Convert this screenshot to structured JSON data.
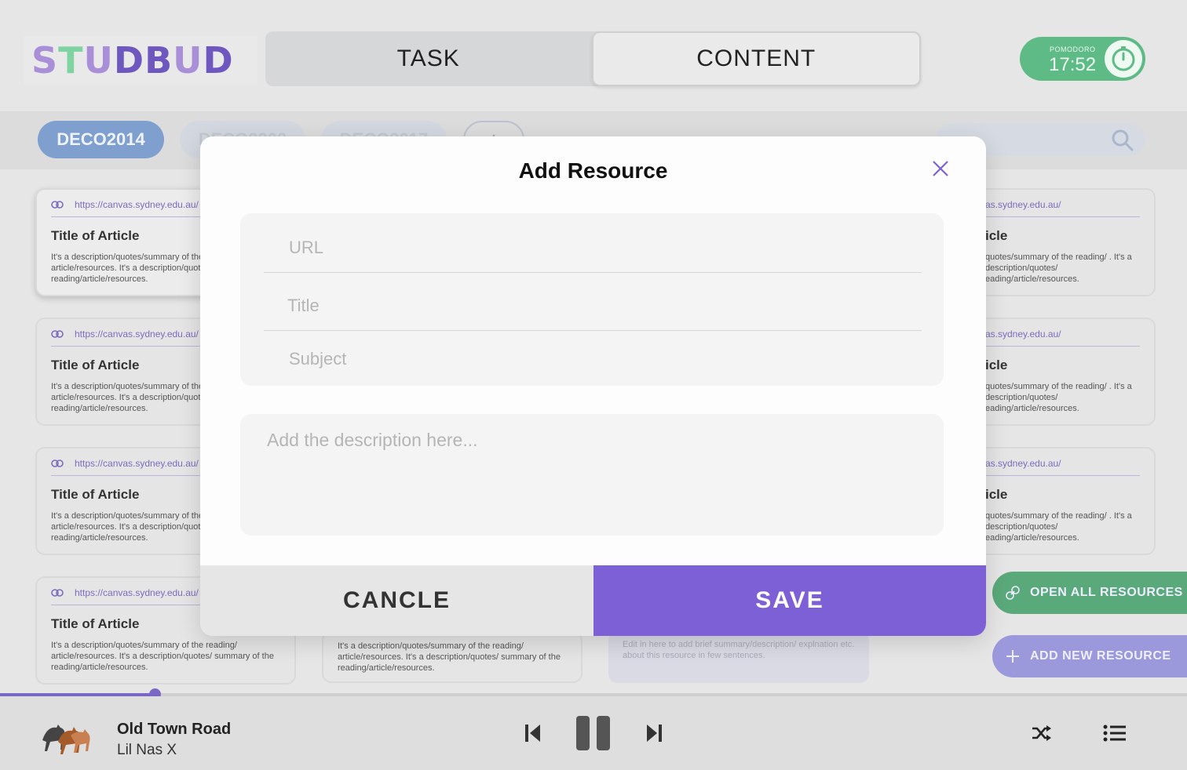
{
  "app": {
    "logo_text": "STUDBUD",
    "logo_letters": [
      "S",
      "T",
      "U",
      "D",
      "B",
      "U",
      "D"
    ]
  },
  "tabs": [
    {
      "label": "TASK",
      "active": false
    },
    {
      "label": "CONTENT",
      "active": true
    }
  ],
  "pomodoro": {
    "label": "POMODORO",
    "time": "17:52"
  },
  "subjects": {
    "chips": [
      {
        "label": "DECO2014",
        "active": true
      },
      {
        "label": "DECO2200",
        "active": false
      },
      {
        "label": "DECO2017",
        "active": false
      }
    ],
    "add_label": "+",
    "search_placeholder": ""
  },
  "cards": {
    "left_url": "https://canvas.sydney.edu.au/",
    "right_url": "as.sydney.edu.au/",
    "title": "Title of Article",
    "right_title": "icle",
    "description": "It's a description/quotes/summary of the reading/ article/resources. It's a description/quotes/ summary of the reading/article/resources.",
    "right_description": "quotes/summary of the reading/ . It's a description/quotes/ eading/article/resources.",
    "bottom_description": "It's a description/quotes/summary of the reading/ article/resources. It's a description/quotes/ summary of the reading/article/resources.",
    "hint": "Edit in here to add brief summary/description/ explnation etc. about this resource in few sentences."
  },
  "actions": {
    "open_all": "OPEN ALL RESOURCES",
    "add_new": "ADD NEW RESOURCE"
  },
  "player": {
    "song": "Old Town Road",
    "artist": "Lil Nas X",
    "progress": 0.13
  },
  "modal": {
    "title": "Add Resource",
    "url_placeholder": "URL",
    "title_placeholder": "Title",
    "subject_placeholder": "Subject",
    "description_placeholder": "Add the description here...",
    "cancel_label": "CANCLE",
    "save_label": "SAVE"
  },
  "colors": {
    "accent_purple": "#7e60d6",
    "green": "#5fbb86",
    "chip_blue": "#7f9fce"
  }
}
